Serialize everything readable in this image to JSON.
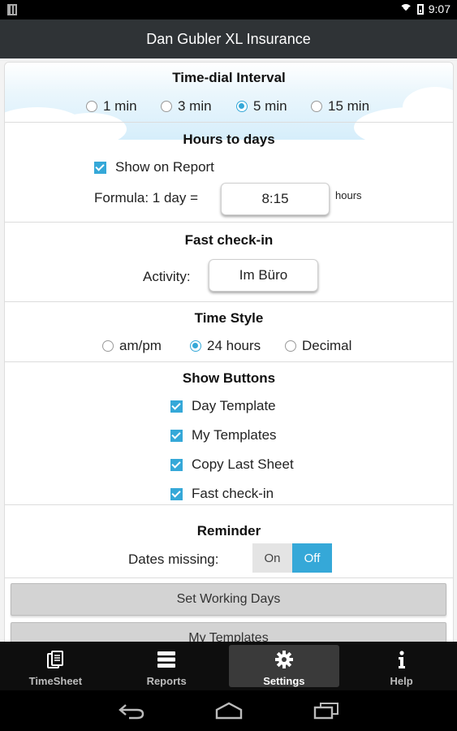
{
  "status": {
    "time": "9:07"
  },
  "app_title": "Dan Gubler XL Insurance",
  "time_dial": {
    "title": "Time-dial Interval",
    "options": [
      "1 min",
      "3 min",
      "5 min",
      "15 min"
    ],
    "selected": "5 min"
  },
  "hours_to_days": {
    "title": "Hours to days",
    "show_on_report_label": "Show on Report",
    "formula_label": "Formula: 1 day =",
    "formula_value": "8:15",
    "unit": "hours"
  },
  "fast_checkin": {
    "title": "Fast check-in",
    "activity_label": "Activity:",
    "activity_value": "Im Büro"
  },
  "time_style": {
    "title": "Time Style",
    "options": [
      "am/pm",
      "24 hours",
      "Decimal"
    ],
    "selected": "24 hours"
  },
  "show_buttons": {
    "title": "Show Buttons",
    "items": [
      "Day Template",
      "My Templates",
      "Copy Last Sheet",
      "Fast check-in"
    ]
  },
  "reminder": {
    "title": "Reminder",
    "dates_missing_label": "Dates missing:",
    "on_label": "On",
    "off_label": "Off",
    "state": "Off"
  },
  "buttons": {
    "set_working_days": "Set Working Days",
    "my_templates": "My Templates"
  },
  "tabs": [
    {
      "label": "TimeSheet",
      "icon": "timesheet-icon"
    },
    {
      "label": "Reports",
      "icon": "reports-icon"
    },
    {
      "label": "Settings",
      "icon": "gear-icon"
    },
    {
      "label": "Help",
      "icon": "info-icon"
    }
  ],
  "active_tab": "Settings",
  "colors": {
    "accent": "#35a8d8",
    "titlebar": "#2f3336",
    "tabbar": "#0e0e0e"
  }
}
